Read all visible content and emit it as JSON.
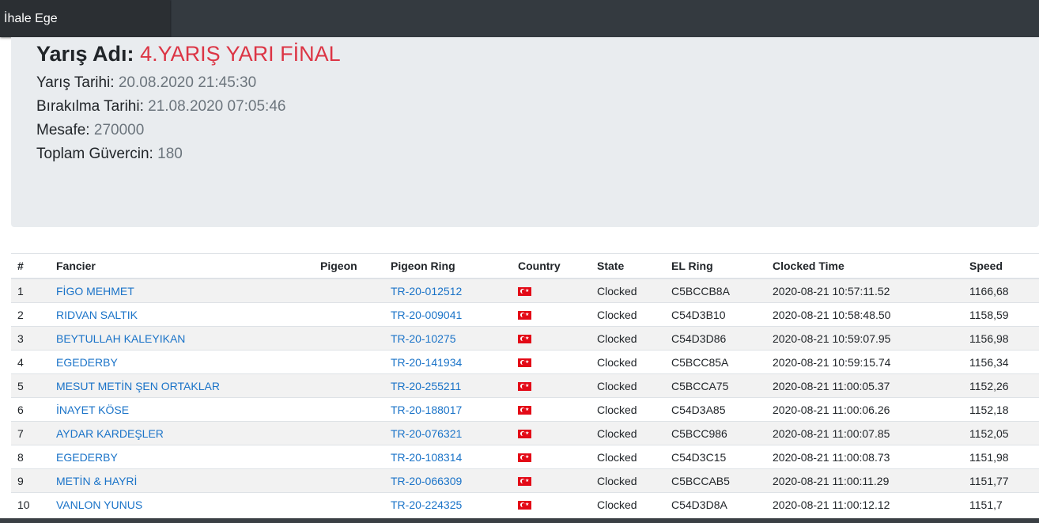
{
  "navbar": {
    "brand": "İhale Ege"
  },
  "race": {
    "title_label": "Yarış Adı:",
    "title_value": "4.YARIŞ YARI FİNAL",
    "date_label": "Yarış Tarihi:",
    "date_value": "20.08.2020 21:45:30",
    "release_label": "Bırakılma Tarihi:",
    "release_value": "21.08.2020 07:05:46",
    "distance_label": "Mesafe:",
    "distance_value": "270000",
    "total_label": "Toplam Güvercin:",
    "total_value": "180"
  },
  "table": {
    "headers": [
      "#",
      "Fancier",
      "Pigeon",
      "Pigeon Ring",
      "Country",
      "State",
      "EL Ring",
      "Clocked Time",
      "Speed"
    ],
    "rows": [
      {
        "rank": "1",
        "fancier": "FİGO MEHMET",
        "pigeon": "",
        "ring": "TR-20-012512",
        "country": "turkey-flag-icon",
        "state": "Clocked",
        "el_ring": "C5BCCB8A",
        "time": "2020-08-21 10:57:11.52",
        "speed": "1166,68"
      },
      {
        "rank": "2",
        "fancier": "RIDVAN SALTIK",
        "pigeon": "",
        "ring": "TR-20-009041",
        "country": "turkey-flag-icon",
        "state": "Clocked",
        "el_ring": "C54D3B10",
        "time": "2020-08-21 10:58:48.50",
        "speed": "1158,59"
      },
      {
        "rank": "3",
        "fancier": "BEYTULLAH KALEYIKAN",
        "pigeon": "",
        "ring": "TR-20-10275",
        "country": "turkey-flag-icon",
        "state": "Clocked",
        "el_ring": "C54D3D86",
        "time": "2020-08-21 10:59:07.95",
        "speed": "1156,98"
      },
      {
        "rank": "4",
        "fancier": "EGEDERBY",
        "pigeon": "",
        "ring": "TR-20-141934",
        "country": "turkey-flag-icon",
        "state": "Clocked",
        "el_ring": "C5BCC85A",
        "time": "2020-08-21 10:59:15.74",
        "speed": "1156,34"
      },
      {
        "rank": "5",
        "fancier": "MESUT METİN ŞEN ORTAKLAR",
        "pigeon": "",
        "ring": "TR-20-255211",
        "country": "turkey-flag-icon",
        "state": "Clocked",
        "el_ring": "C5BCCA75",
        "time": "2020-08-21 11:00:05.37",
        "speed": "1152,26"
      },
      {
        "rank": "6",
        "fancier": "İNAYET KÖSE",
        "pigeon": "",
        "ring": "TR-20-188017",
        "country": "turkey-flag-icon",
        "state": "Clocked",
        "el_ring": "C54D3A85",
        "time": "2020-08-21 11:00:06.26",
        "speed": "1152,18"
      },
      {
        "rank": "7",
        "fancier": "AYDAR KARDEŞLER",
        "pigeon": "",
        "ring": "TR-20-076321",
        "country": "turkey-flag-icon",
        "state": "Clocked",
        "el_ring": "C5BCC986",
        "time": "2020-08-21 11:00:07.85",
        "speed": "1152,05"
      },
      {
        "rank": "8",
        "fancier": "EGEDERBY",
        "pigeon": "",
        "ring": "TR-20-108314",
        "country": "turkey-flag-icon",
        "state": "Clocked",
        "el_ring": "C54D3C15",
        "time": "2020-08-21 11:00:08.73",
        "speed": "1151,98"
      },
      {
        "rank": "9",
        "fancier": "METİN & HAYRİ",
        "pigeon": "",
        "ring": "TR-20-066309",
        "country": "turkey-flag-icon",
        "state": "Clocked",
        "el_ring": "C5BCCAB5",
        "time": "2020-08-21 11:00:11.29",
        "speed": "1151,77"
      },
      {
        "rank": "10",
        "fancier": "VANLON YUNUS",
        "pigeon": "",
        "ring": "TR-20-224325",
        "country": "turkey-flag-icon",
        "state": "Clocked",
        "el_ring": "C54D3D8A",
        "time": "2020-08-21 11:00:12.12",
        "speed": "1151,7"
      }
    ]
  },
  "colors": {
    "navbar_bg": "#343a40",
    "accent_red": "#dc3545",
    "link_blue": "#1a73c8",
    "panel_bg": "#e9ecef",
    "flag_red": "#e30a17"
  }
}
